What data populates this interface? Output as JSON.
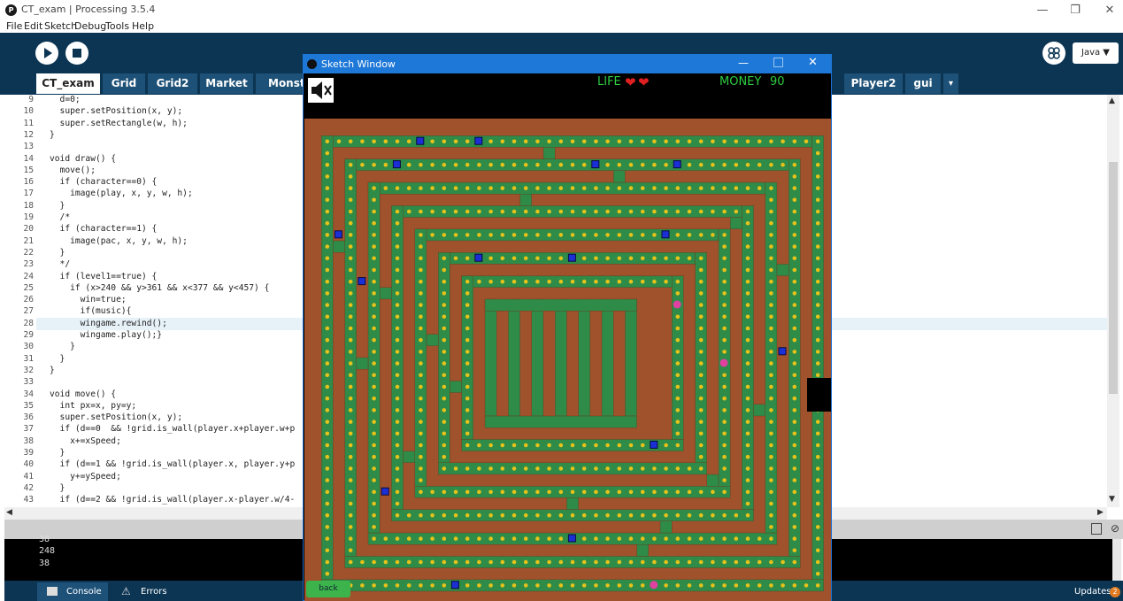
{
  "window": {
    "title": "CT_exam | Processing 3.5.4",
    "app_icon": "processing-p-icon"
  },
  "menu": [
    "File",
    "Edit",
    "Sketch",
    "Debug",
    "Tools",
    "Help"
  ],
  "toolbar": {
    "run_icon": "play-icon",
    "stop_icon": "stop-icon",
    "debug_icon": "debugger-icon",
    "mode": "Java ▼"
  },
  "tabs": [
    "CT_exam",
    "Grid",
    "Grid2",
    "Market",
    "Monster",
    "Player2",
    "gui",
    "▾"
  ],
  "editor": {
    "highlighted_line": 28,
    "lines": [
      {
        "n": "9",
        "t": "  d=0;"
      },
      {
        "n": "10",
        "t": "  super.setPosition(x, y);"
      },
      {
        "n": "11",
        "t": "  super.setRectangle(w, h);"
      },
      {
        "n": "12",
        "t": "}"
      },
      {
        "n": "13",
        "t": ""
      },
      {
        "n": "14",
        "t": "void draw() {"
      },
      {
        "n": "15",
        "t": "  move();"
      },
      {
        "n": "16",
        "t": "  if (character==0) {"
      },
      {
        "n": "17",
        "t": "    image(play, x, y, w, h);"
      },
      {
        "n": "18",
        "t": "  }"
      },
      {
        "n": "19",
        "t": "  /*"
      },
      {
        "n": "20",
        "t": "  if (character==1) {"
      },
      {
        "n": "21",
        "t": "    image(pac, x, y, w, h);"
      },
      {
        "n": "22",
        "t": "  }"
      },
      {
        "n": "23",
        "t": "  */"
      },
      {
        "n": "24",
        "t": "  if (level1==true) {"
      },
      {
        "n": "25",
        "t": "    if (x>240 && y>361 && x<377 && y<457) {"
      },
      {
        "n": "26",
        "t": "      win=true;"
      },
      {
        "n": "27",
        "t": "      if(music){"
      },
      {
        "n": "28",
        "t": "      wingame.rewind();"
      },
      {
        "n": "29",
        "t": "      wingame.play();}"
      },
      {
        "n": "30",
        "t": "    }"
      },
      {
        "n": "31",
        "t": "  }"
      },
      {
        "n": "32",
        "t": "}"
      },
      {
        "n": "33",
        "t": ""
      },
      {
        "n": "34",
        "t": "void move() {"
      },
      {
        "n": "35",
        "t": "  int px=x, py=y;"
      },
      {
        "n": "36",
        "t": "  super.setPosition(x, y);"
      },
      {
        "n": "37",
        "t": "  if (d==0  && !grid.is_wall(player.x+player.w+p"
      },
      {
        "n": "38",
        "t": "    x+=xSpeed;"
      },
      {
        "n": "39",
        "t": "  }"
      },
      {
        "n": "40",
        "t": "  if (d==1 && !grid.is_wall(player.x, player.y+p"
      },
      {
        "n": "41",
        "t": "    y+=ySpeed;"
      },
      {
        "n": "42",
        "t": "  }"
      },
      {
        "n": "43",
        "t": "  if (d==2 && !grid.is_wall(player.x-player.w/4-"
      }
    ]
  },
  "console": {
    "lines": [
      "38",
      "248",
      "38"
    ]
  },
  "footer": {
    "console": "Console",
    "errors": "Errors",
    "updates": "Updates",
    "updates_count": "2"
  },
  "sketch": {
    "title": "Sketch Window",
    "life_label": "LIFE",
    "money_label": "MONEY",
    "money_value": "90",
    "back_label": "back",
    "mute_icon": "speaker-muted-icon",
    "colors": {
      "dirt": "#a0522d",
      "grass": "#2e8b48",
      "coin": "#e6c21a",
      "wall_edge": "#6b3a1c"
    }
  }
}
